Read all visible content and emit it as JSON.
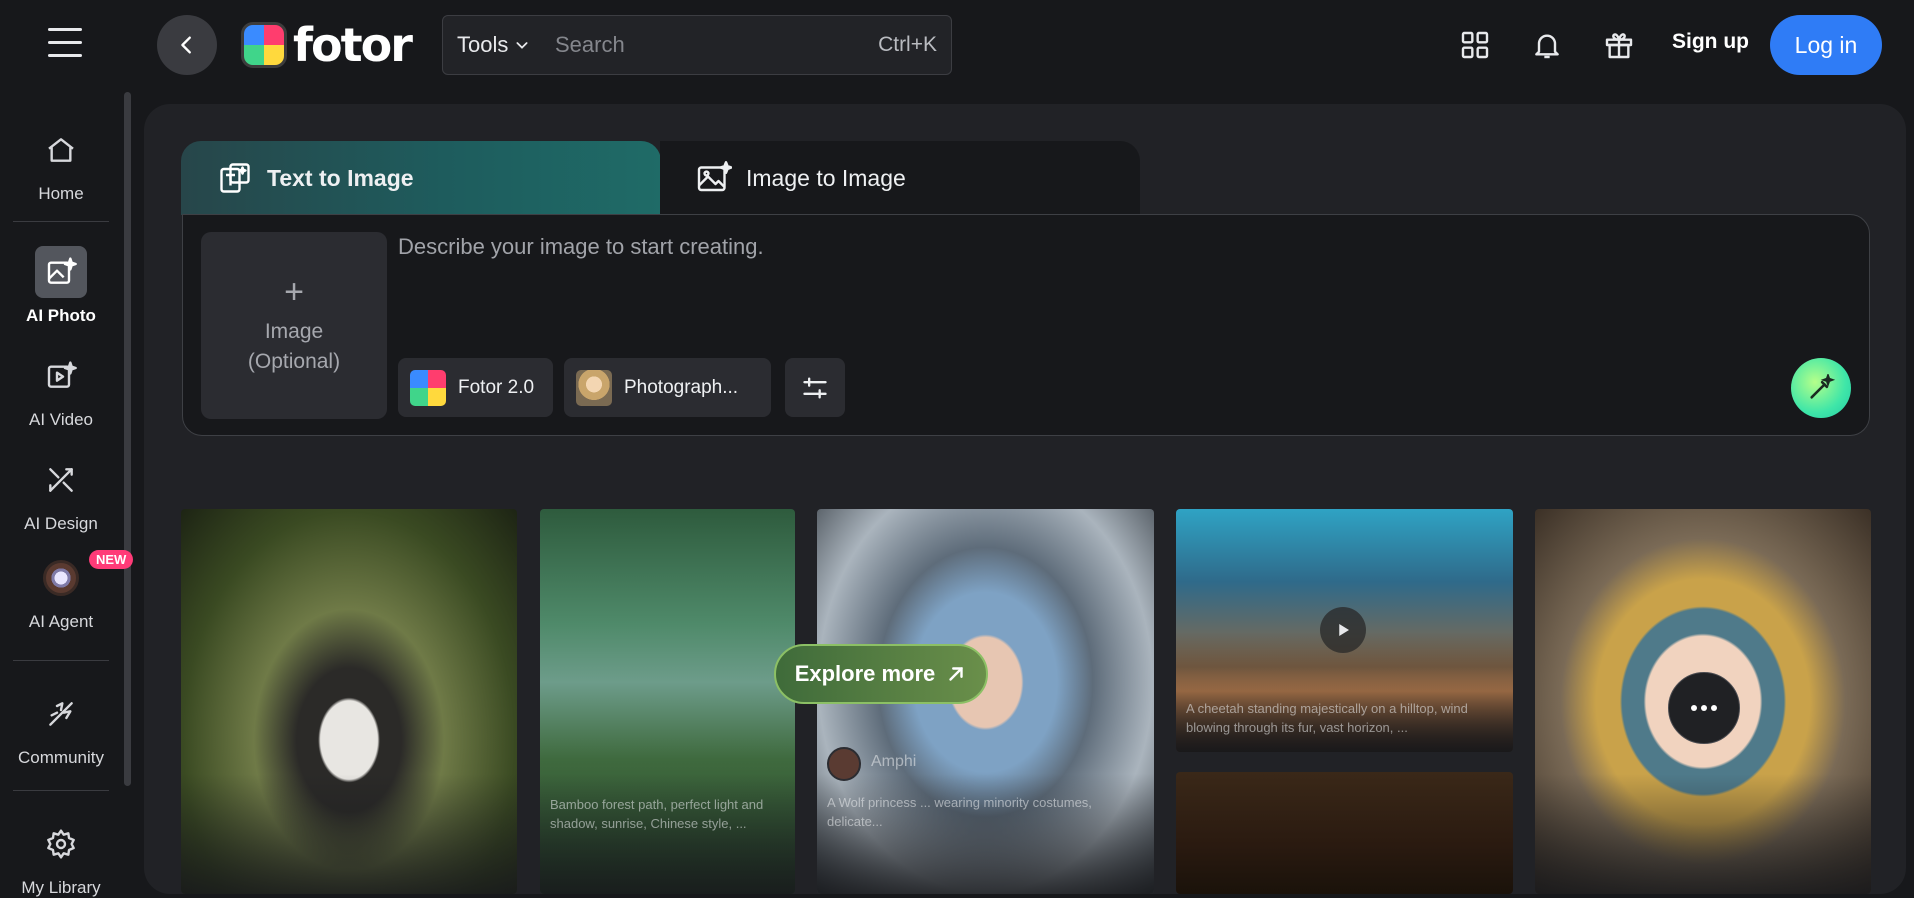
{
  "header": {
    "logo_text": "fotor",
    "tools_label": "Tools",
    "search_placeholder": "Search",
    "search_shortcut": "Ctrl+K",
    "signup_label": "Sign up",
    "login_label": "Log in",
    "icons": [
      "menu-icon",
      "back-arrow-icon",
      "apps-grid-icon",
      "bell-icon",
      "gift-icon"
    ]
  },
  "sidebar": {
    "items": [
      {
        "label": "Home",
        "icon": "home-icon"
      },
      {
        "label": "AI Photo",
        "icon": "ai-photo-icon",
        "active": true
      },
      {
        "label": "AI Video",
        "icon": "ai-video-icon"
      },
      {
        "label": "AI Design",
        "icon": "ai-design-icon"
      },
      {
        "label": "AI Agent",
        "icon": "ai-agent-icon",
        "badge": "NEW"
      },
      {
        "label": "Community",
        "icon": "community-icon"
      },
      {
        "label": "My Library",
        "icon": "settings-gear-icon"
      }
    ]
  },
  "generator": {
    "tabs": [
      {
        "label": "Text to Image",
        "active": true
      },
      {
        "label": "Image to Image",
        "active": false
      }
    ],
    "image_upload": {
      "plus": "+",
      "line1": "Image",
      "line2": "(Optional)"
    },
    "prompt_placeholder": "Describe your image to start creating.",
    "model_chip": "Fotor 2.0",
    "style_chip": "Photograph..."
  },
  "gallery": {
    "items": [
      {
        "caption": ""
      },
      {
        "caption": "Bamboo forest path, perfect light and shadow, sunrise, Chinese style, ..."
      },
      {
        "caption": "A Wolf princess ... wearing minority costumes, delicate...",
        "author": "Amphi"
      },
      {
        "caption": "A cheetah standing majestically on a hilltop, wind blowing through its fur, vast horizon, ..."
      },
      {
        "caption": ""
      },
      {
        "caption": ""
      }
    ],
    "explore_label": "Explore more"
  },
  "colors": {
    "accent": "#2f7cf6",
    "background": "#17181b",
    "panel": "#212226",
    "tab_active_start": "#27464a",
    "tab_active_end": "#1f6b67",
    "explore_border": "#8cc065"
  }
}
